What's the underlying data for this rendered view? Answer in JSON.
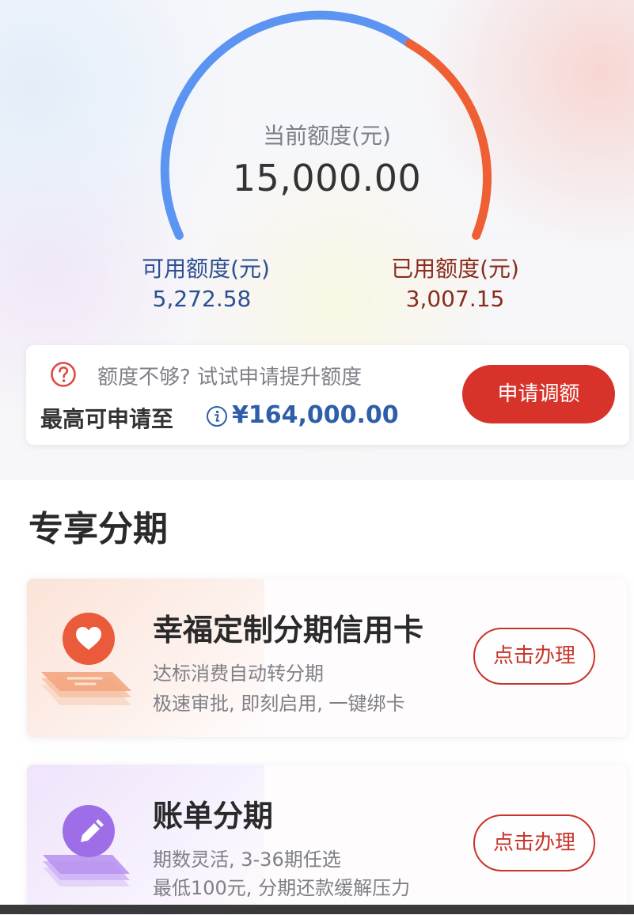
{
  "credit": {
    "current_label": "当前额度(元)",
    "total_value": "15,000.00",
    "available_label": "可用额度(元)",
    "available_value": "5,272.58",
    "used_label": "已用额度(元)",
    "used_value": "3,007.15",
    "available_color": "#5b94f1",
    "used_color": "#ee6033"
  },
  "promo": {
    "question_icon": "question-circle-icon",
    "prompt_text": "额度不够? 试试申请提升额度",
    "max_label": "最高可申请至",
    "info_icon": "info-icon",
    "max_value": "¥164,000.00",
    "apply_button": "申请调额",
    "button_color": "#d8332b"
  },
  "section": {
    "title": "专享分期"
  },
  "products": [
    {
      "icon": "heart-icon",
      "title": "幸福定制分期信用卡",
      "line1": "达标消费自动转分期",
      "line2": "极速审批, 即刻启用, 一键绑卡",
      "button": "点击办理"
    },
    {
      "icon": "pencil-icon",
      "title": "账单分期",
      "line1": "期数灵活, 3-36期任选",
      "line2": "最低100元, 分期还款缓解压力",
      "button": "点击办理"
    }
  ]
}
